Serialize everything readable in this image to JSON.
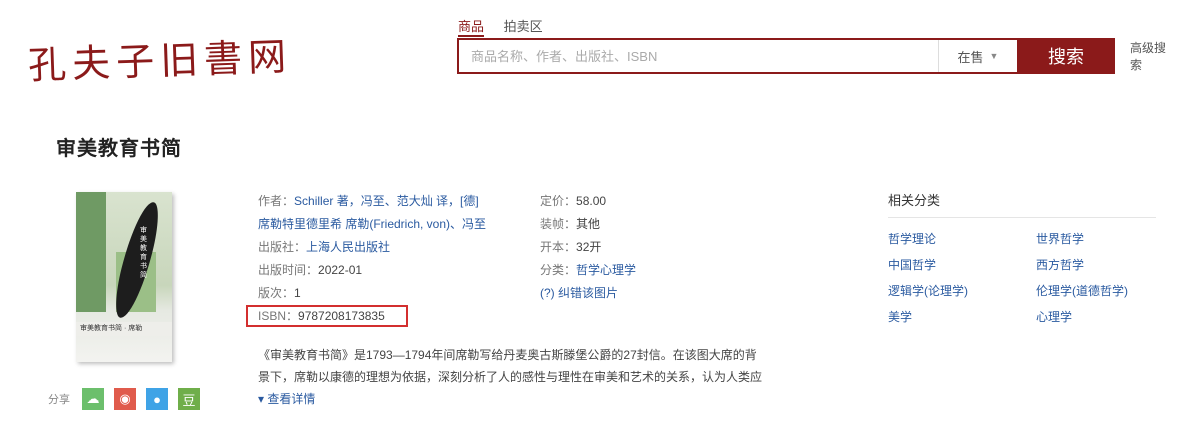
{
  "logo": "孔夫子旧書网",
  "search": {
    "tabs": [
      "商品",
      "拍卖区"
    ],
    "placeholder": "商品名称、作者、出版社、ISBN",
    "scope": "在售",
    "button": "搜索",
    "advanced": "高级搜索"
  },
  "book": {
    "title": "审美教育书简",
    "cover_title": "审美教育书简",
    "cover_band": "审美教育书简 · 席勒"
  },
  "info": {
    "author_label": "作者：",
    "author_value": "Schiller 著，冯至、范大灿 译，[德]",
    "foreign_author": "席勒特里德里希 席勒(Friedrich, von)、冯至",
    "publisher_label": "出版社：",
    "publisher_value": "上海人民出版社",
    "date_label": "出版时间：",
    "date_value": "2022-01",
    "edition_label": "版次：",
    "edition_value": "1",
    "isbn_label": "ISBN：",
    "isbn_value": "9787208173835",
    "price_label": "定价：",
    "price_value": "58.00",
    "binding_label": "装帧：",
    "binding_value": "其他",
    "format_label": "开本：",
    "format_value": "32开",
    "category_label": "分类：",
    "category_value": "哲学心理学",
    "report_link": "(?) 纠错该图片"
  },
  "related": {
    "title": "相关分类",
    "items": [
      "哲学理论",
      "世界哲学",
      "中国哲学",
      "西方哲学",
      "逻辑学(论理学)",
      "伦理学(道德哲学)",
      "美学",
      "心理学"
    ]
  },
  "description": {
    "line1": "《审美教育书简》是1793—1794年间席勒写给丹麦奥古斯滕堡公爵的27封信。在该图大席的背",
    "line2": "景下，席勒以康德的理想为依据，深刻分析了人的感性与理性在审美和艺术的关系，认为人类应",
    "more": "▾ 查看详情"
  },
  "share": {
    "label": "分享"
  },
  "colors": {
    "brand": "#8b1a1a",
    "link": "#2a5aa0",
    "highlight_box": "#d32f2f"
  }
}
